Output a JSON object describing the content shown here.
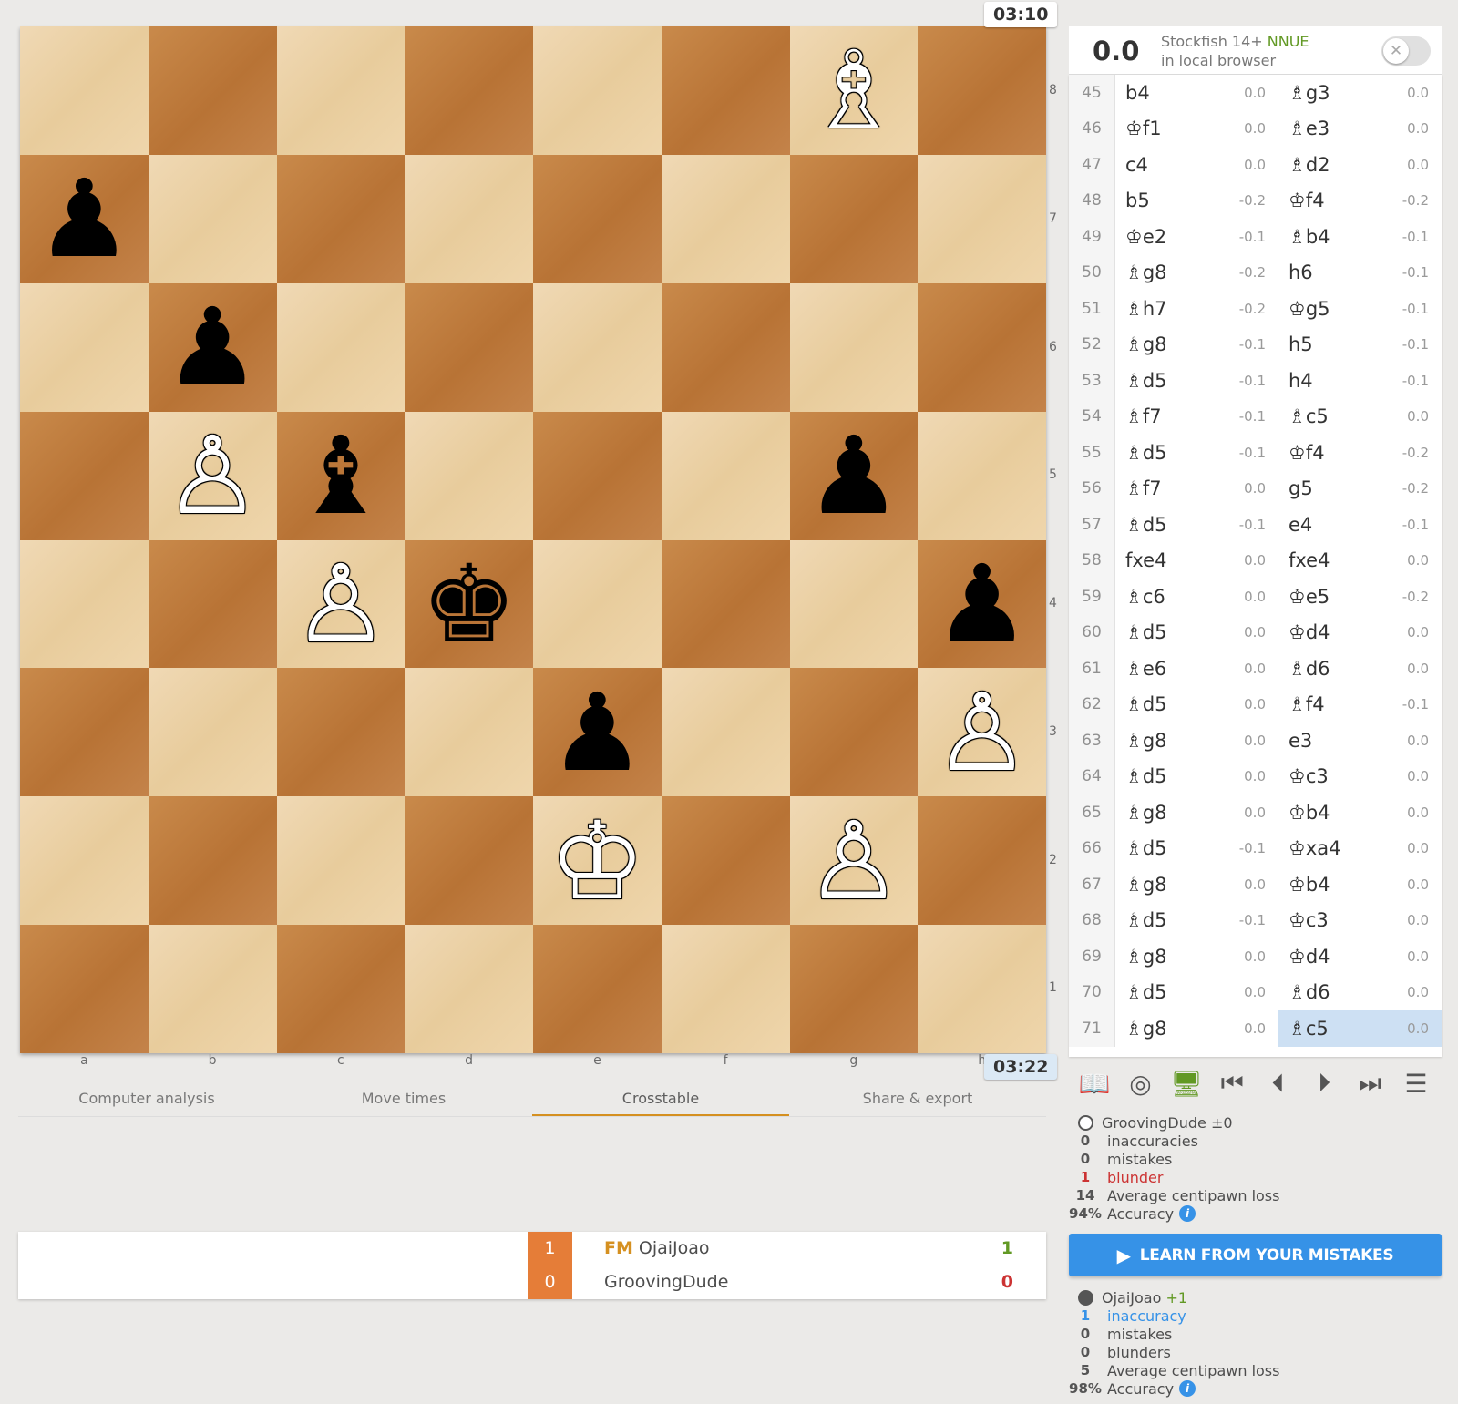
{
  "clocks": {
    "top": "03:10",
    "bottom": "03:22"
  },
  "board": {
    "files": [
      "a",
      "b",
      "c",
      "d",
      "e",
      "f",
      "g",
      "h"
    ],
    "ranks": [
      "8",
      "7",
      "6",
      "5",
      "4",
      "3",
      "2",
      "1"
    ],
    "squares": [
      [
        "",
        "",
        "",
        "",
        "",
        "",
        "wB",
        ""
      ],
      [
        "bP",
        "",
        "",
        "",
        "",
        "",
        "",
        ""
      ],
      [
        "",
        "bP",
        "",
        "",
        "",
        "",
        "",
        ""
      ],
      [
        "",
        "wP",
        "bB",
        "",
        "",
        "",
        "bP",
        ""
      ],
      [
        "",
        "",
        "wP",
        "bK",
        "",
        "",
        "",
        "bP"
      ],
      [
        "",
        "",
        "",
        "",
        "bP",
        "",
        "",
        "wP"
      ],
      [
        "",
        "",
        "",
        "",
        "wK",
        "",
        "wP",
        ""
      ],
      [
        "",
        "",
        "",
        "",
        "",
        "",
        "",
        ""
      ]
    ],
    "glyphs": {
      "wK": "♔",
      "wB": "♗",
      "wP": "♙",
      "bK": "♚",
      "bB": "♝",
      "bP": "♟"
    }
  },
  "tabs": [
    "Computer analysis",
    "Move times",
    "Crosstable",
    "Share & export"
  ],
  "active_tab": 2,
  "crosstable": {
    "rows": [
      {
        "score": "1",
        "title": "FM",
        "name": "OjaiJoao",
        "result": "1",
        "result_color": "#629924"
      },
      {
        "score": "0",
        "title": "",
        "name": "GroovingDude",
        "result": "0",
        "result_color": "#cc3333"
      }
    ]
  },
  "engine": {
    "eval": "0.0",
    "name_line1": "Stockfish 14+",
    "nnue": "NNUE",
    "name_line2": "in local browser",
    "toggle_icon": "✕"
  },
  "moves": [
    {
      "n": "45",
      "w": "b4",
      "we": "0.0",
      "b": "♗g3",
      "be": "0.0"
    },
    {
      "n": "46",
      "w": "♔f1",
      "we": "0.0",
      "b": "♗e3",
      "be": "0.0"
    },
    {
      "n": "47",
      "w": "c4",
      "we": "0.0",
      "b": "♗d2",
      "be": "0.0"
    },
    {
      "n": "48",
      "w": "b5",
      "we": "-0.2",
      "b": "♔f4",
      "be": "-0.2"
    },
    {
      "n": "49",
      "w": "♔e2",
      "we": "-0.1",
      "b": "♗b4",
      "be": "-0.1"
    },
    {
      "n": "50",
      "w": "♗g8",
      "we": "-0.2",
      "b": "h6",
      "be": "-0.1"
    },
    {
      "n": "51",
      "w": "♗h7",
      "we": "-0.2",
      "b": "♔g5",
      "be": "-0.1"
    },
    {
      "n": "52",
      "w": "♗g8",
      "we": "-0.1",
      "b": "h5",
      "be": "-0.1"
    },
    {
      "n": "53",
      "w": "♗d5",
      "we": "-0.1",
      "b": "h4",
      "be": "-0.1"
    },
    {
      "n": "54",
      "w": "♗f7",
      "we": "-0.1",
      "b": "♗c5",
      "be": "0.0"
    },
    {
      "n": "55",
      "w": "♗d5",
      "we": "-0.1",
      "b": "♔f4",
      "be": "-0.2"
    },
    {
      "n": "56",
      "w": "♗f7",
      "we": "0.0",
      "b": "g5",
      "be": "-0.2"
    },
    {
      "n": "57",
      "w": "♗d5",
      "we": "-0.1",
      "b": "e4",
      "be": "-0.1"
    },
    {
      "n": "58",
      "w": "fxe4",
      "we": "0.0",
      "b": "fxe4",
      "be": "0.0"
    },
    {
      "n": "59",
      "w": "♗c6",
      "we": "0.0",
      "b": "♔e5",
      "be": "-0.2"
    },
    {
      "n": "60",
      "w": "♗d5",
      "we": "0.0",
      "b": "♔d4",
      "be": "0.0"
    },
    {
      "n": "61",
      "w": "♗e6",
      "we": "0.0",
      "b": "♗d6",
      "be": "0.0"
    },
    {
      "n": "62",
      "w": "♗d5",
      "we": "0.0",
      "b": "♗f4",
      "be": "-0.1"
    },
    {
      "n": "63",
      "w": "♗g8",
      "we": "0.0",
      "b": "e3",
      "be": "0.0"
    },
    {
      "n": "64",
      "w": "♗d5",
      "we": "0.0",
      "b": "♔c3",
      "be": "0.0"
    },
    {
      "n": "65",
      "w": "♗g8",
      "we": "0.0",
      "b": "♔b4",
      "be": "0.0"
    },
    {
      "n": "66",
      "w": "♗d5",
      "we": "-0.1",
      "b": "♔xa4",
      "be": "0.0"
    },
    {
      "n": "67",
      "w": "♗g8",
      "we": "0.0",
      "b": "♔b4",
      "be": "0.0"
    },
    {
      "n": "68",
      "w": "♗d5",
      "we": "-0.1",
      "b": "♔c3",
      "be": "0.0"
    },
    {
      "n": "69",
      "w": "♗g8",
      "we": "0.0",
      "b": "♔d4",
      "be": "0.0"
    },
    {
      "n": "70",
      "w": "♗d5",
      "we": "0.0",
      "b": "♗d6",
      "be": "0.0"
    },
    {
      "n": "71",
      "w": "♗g8",
      "we": "0.0",
      "b": "♗c5",
      "be": "0.0",
      "active": "b"
    }
  ],
  "controls": [
    "book-icon",
    "target-icon",
    "computer-icon",
    "first-icon",
    "prev-icon",
    "next-icon",
    "last-icon",
    "menu-icon"
  ],
  "summary_white": {
    "player": "GroovingDude",
    "delta": "±0",
    "inaccuracies_n": "0",
    "inaccuracies": "inaccuracies",
    "mistakes_n": "0",
    "mistakes": "mistakes",
    "blunders_n": "1",
    "blunders": "blunder",
    "acpl_n": "14",
    "acpl": "Average centipawn loss",
    "accuracy_n": "94%",
    "accuracy": "Accuracy"
  },
  "learn_button": "Learn from your mistakes",
  "summary_black": {
    "player": "OjaiJoao",
    "delta": "+1",
    "inaccuracies_n": "1",
    "inaccuracies": "inaccuracy",
    "mistakes_n": "0",
    "mistakes": "mistakes",
    "blunders_n": "0",
    "blunders": "blunders",
    "acpl_n": "5",
    "acpl": "Average centipawn loss",
    "accuracy_n": "98%",
    "accuracy": "Accuracy"
  }
}
